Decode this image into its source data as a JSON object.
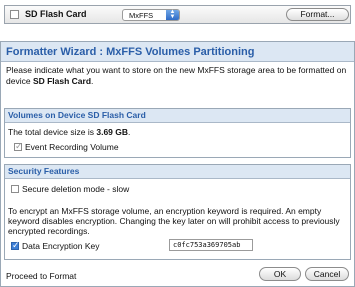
{
  "top_strip": {
    "card_label": "SD Flash Card",
    "format_type": "MxFFS",
    "format_button": "Format..."
  },
  "wizard": {
    "title": "Formatter Wizard : MxFFS Volumes Partitioning",
    "intro_text": "Please indicate what you want to store on the new MxFFS storage area to be formatted on device ",
    "intro_device": "SD Flash Card",
    "intro_end": ".",
    "volumes": {
      "header": "Volumes on Device SD Flash Card",
      "size_prefix": "The total device size is ",
      "size_value": "3.69 GB",
      "size_suffix": ".",
      "event_recording": "Event Recording Volume"
    },
    "security": {
      "header": "Security Features",
      "secure_deletion": "Secure deletion mode - slow",
      "note": "To encrypt an MxFFS storage volume, an encryption keyword is required. An empty keyword disables encryption. Changing the key later on will prohibit access to previously encrypted recordings.",
      "data_encryption_label": "Data Encryption Key",
      "data_encryption_value": "c0fc753a369705ab"
    },
    "proceed_label": "Proceed to Format",
    "ok_button": "OK",
    "cancel_button": "Cancel"
  }
}
